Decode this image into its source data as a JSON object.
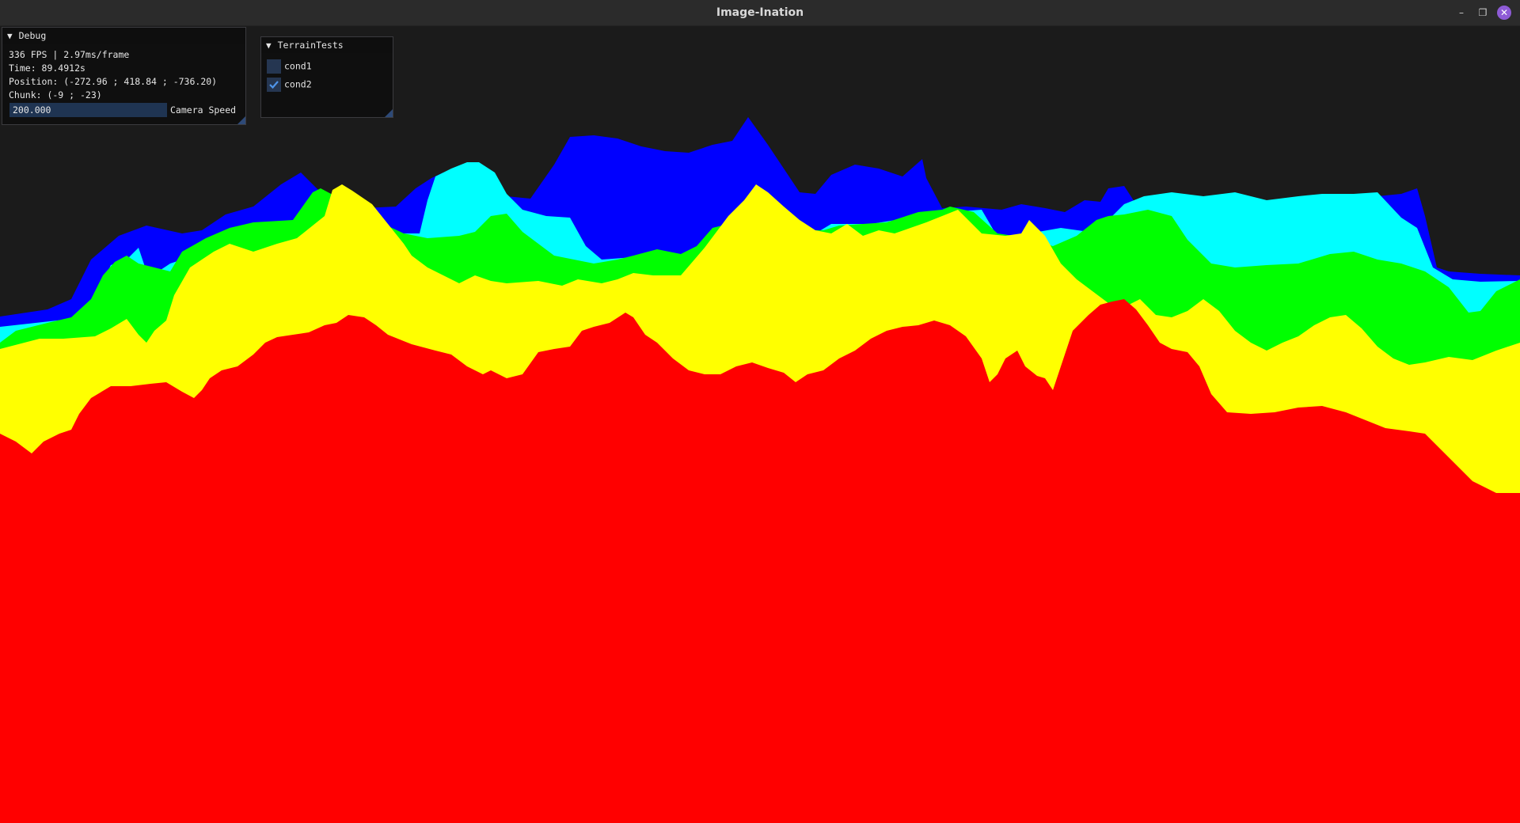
{
  "window": {
    "title": "Image-Ination",
    "minimize_icon": "minimize-icon",
    "maximize_icon": "restore-icon",
    "close_icon": "close-icon"
  },
  "debug_panel": {
    "title": "Debug",
    "fps": "336 FPS | 2.97ms/frame",
    "time": "Time: 89.4912s",
    "position": "Position: (-272.96 ; 418.84 ; -736.20)",
    "chunk": "Chunk: (-9 ; -23)",
    "camera_speed_value": "200.000",
    "camera_speed_label": "Camera Speed"
  },
  "terrain_panel": {
    "title": "TerrainTests",
    "checkboxes": [
      {
        "label": "cond1",
        "checked": false
      },
      {
        "label": "cond2",
        "checked": true
      }
    ]
  },
  "colors": {
    "background": "#1b1b1b",
    "layer_blue": "#0000ff",
    "layer_cyan": "#00ffff",
    "layer_green": "#00ff00",
    "layer_yellow": "#ffff00",
    "layer_red": "#ff0000",
    "accent": "#2e4a78"
  }
}
